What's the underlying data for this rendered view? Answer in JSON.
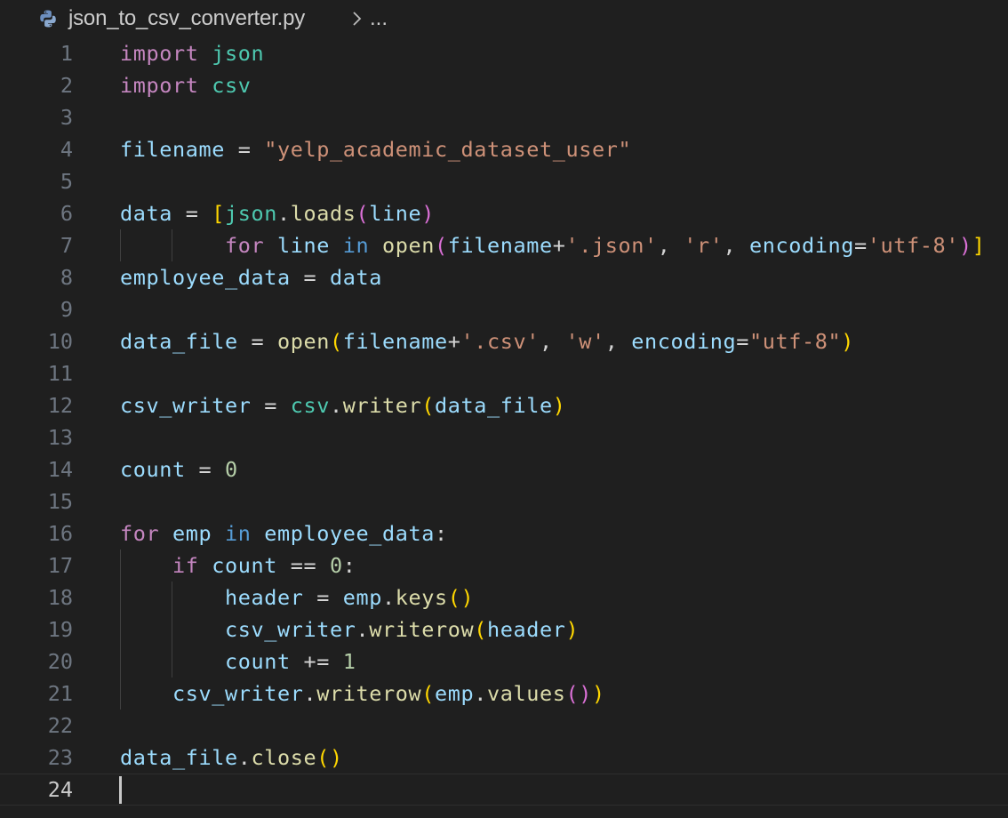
{
  "breadcrumb": {
    "file_icon": "python-icon",
    "filename": "json_to_csv_converter.py",
    "separator_icon": "chevron-right-icon",
    "ellipsis": "..."
  },
  "editor": {
    "current_line": 24,
    "colors": {
      "background": "#1f1f1f",
      "keyword": "#c586c0",
      "keyword_blue": "#569cd6",
      "module": "#4ec9b0",
      "variable": "#9cdcfe",
      "string": "#ce9178",
      "function": "#dcdcaa",
      "number": "#b5cea8",
      "bracket_level1": "#ffd700",
      "bracket_level2": "#da70d6",
      "line_number": "#6e7681"
    },
    "lines": [
      {
        "n": "1",
        "tokens": [
          [
            "kw",
            "import"
          ],
          [
            "op",
            " "
          ],
          [
            "mod",
            "json"
          ]
        ]
      },
      {
        "n": "2",
        "tokens": [
          [
            "kw",
            "import"
          ],
          [
            "op",
            " "
          ],
          [
            "mod",
            "csv"
          ]
        ]
      },
      {
        "n": "3",
        "tokens": []
      },
      {
        "n": "4",
        "tokens": [
          [
            "var",
            "filename"
          ],
          [
            "op",
            " = "
          ],
          [
            "str",
            "\"yelp_academic_dataset_user\""
          ]
        ]
      },
      {
        "n": "5",
        "tokens": []
      },
      {
        "n": "6",
        "tokens": [
          [
            "var",
            "data"
          ],
          [
            "op",
            " = "
          ],
          [
            "p1",
            "["
          ],
          [
            "mod",
            "json"
          ],
          [
            "op",
            "."
          ],
          [
            "fn",
            "loads"
          ],
          [
            "p2",
            "("
          ],
          [
            "var",
            "line"
          ],
          [
            "p2",
            ")"
          ]
        ]
      },
      {
        "n": "7",
        "tokens": [
          [
            "op",
            "        "
          ],
          [
            "kw",
            "for"
          ],
          [
            "op",
            " "
          ],
          [
            "var",
            "line"
          ],
          [
            "op",
            " "
          ],
          [
            "kb",
            "in"
          ],
          [
            "op",
            " "
          ],
          [
            "fn",
            "open"
          ],
          [
            "p2",
            "("
          ],
          [
            "var",
            "filename"
          ],
          [
            "op",
            "+"
          ],
          [
            "str",
            "'.json'"
          ],
          [
            "op",
            ", "
          ],
          [
            "str",
            "'r'"
          ],
          [
            "op",
            ", "
          ],
          [
            "var",
            "encoding"
          ],
          [
            "op",
            "="
          ],
          [
            "str",
            "'utf-8'"
          ],
          [
            "p2",
            ")"
          ],
          [
            "p1",
            "]"
          ]
        ]
      },
      {
        "n": "8",
        "tokens": [
          [
            "var",
            "employee_data"
          ],
          [
            "op",
            " = "
          ],
          [
            "var",
            "data"
          ]
        ]
      },
      {
        "n": "9",
        "tokens": []
      },
      {
        "n": "10",
        "tokens": [
          [
            "var",
            "data_file"
          ],
          [
            "op",
            " = "
          ],
          [
            "fn",
            "open"
          ],
          [
            "p1",
            "("
          ],
          [
            "var",
            "filename"
          ],
          [
            "op",
            "+"
          ],
          [
            "str",
            "'.csv'"
          ],
          [
            "op",
            ", "
          ],
          [
            "str",
            "'w'"
          ],
          [
            "op",
            ", "
          ],
          [
            "var",
            "encoding"
          ],
          [
            "op",
            "="
          ],
          [
            "str",
            "\"utf-8\""
          ],
          [
            "p1",
            ")"
          ]
        ]
      },
      {
        "n": "11",
        "tokens": []
      },
      {
        "n": "12",
        "tokens": [
          [
            "var",
            "csv_writer"
          ],
          [
            "op",
            " = "
          ],
          [
            "mod",
            "csv"
          ],
          [
            "op",
            "."
          ],
          [
            "fn",
            "writer"
          ],
          [
            "p1",
            "("
          ],
          [
            "var",
            "data_file"
          ],
          [
            "p1",
            ")"
          ]
        ]
      },
      {
        "n": "13",
        "tokens": []
      },
      {
        "n": "14",
        "tokens": [
          [
            "var",
            "count"
          ],
          [
            "op",
            " = "
          ],
          [
            "num",
            "0"
          ]
        ]
      },
      {
        "n": "15",
        "tokens": []
      },
      {
        "n": "16",
        "tokens": [
          [
            "kw",
            "for"
          ],
          [
            "op",
            " "
          ],
          [
            "var",
            "emp"
          ],
          [
            "op",
            " "
          ],
          [
            "kb",
            "in"
          ],
          [
            "op",
            " "
          ],
          [
            "var",
            "employee_data"
          ],
          [
            "op",
            ":"
          ]
        ]
      },
      {
        "n": "17",
        "tokens": [
          [
            "op",
            "    "
          ],
          [
            "kw",
            "if"
          ],
          [
            "op",
            " "
          ],
          [
            "var",
            "count"
          ],
          [
            "op",
            " == "
          ],
          [
            "num",
            "0"
          ],
          [
            "op",
            ":"
          ]
        ]
      },
      {
        "n": "18",
        "tokens": [
          [
            "op",
            "        "
          ],
          [
            "var",
            "header"
          ],
          [
            "op",
            " = "
          ],
          [
            "var",
            "emp"
          ],
          [
            "op",
            "."
          ],
          [
            "fn",
            "keys"
          ],
          [
            "p1",
            "()"
          ]
        ]
      },
      {
        "n": "19",
        "tokens": [
          [
            "op",
            "        "
          ],
          [
            "var",
            "csv_writer"
          ],
          [
            "op",
            "."
          ],
          [
            "fn",
            "writerow"
          ],
          [
            "p1",
            "("
          ],
          [
            "var",
            "header"
          ],
          [
            "p1",
            ")"
          ]
        ]
      },
      {
        "n": "20",
        "tokens": [
          [
            "op",
            "        "
          ],
          [
            "var",
            "count"
          ],
          [
            "op",
            " += "
          ],
          [
            "num",
            "1"
          ]
        ]
      },
      {
        "n": "21",
        "tokens": [
          [
            "op",
            "    "
          ],
          [
            "var",
            "csv_writer"
          ],
          [
            "op",
            "."
          ],
          [
            "fn",
            "writerow"
          ],
          [
            "p1",
            "("
          ],
          [
            "var",
            "emp"
          ],
          [
            "op",
            "."
          ],
          [
            "fn",
            "values"
          ],
          [
            "p2",
            "()"
          ],
          [
            "p1",
            ")"
          ]
        ]
      },
      {
        "n": "22",
        "tokens": []
      },
      {
        "n": "23",
        "tokens": [
          [
            "var",
            "data_file"
          ],
          [
            "op",
            "."
          ],
          [
            "fn",
            "close"
          ],
          [
            "p1",
            "()"
          ]
        ]
      },
      {
        "n": "24",
        "tokens": []
      }
    ]
  }
}
